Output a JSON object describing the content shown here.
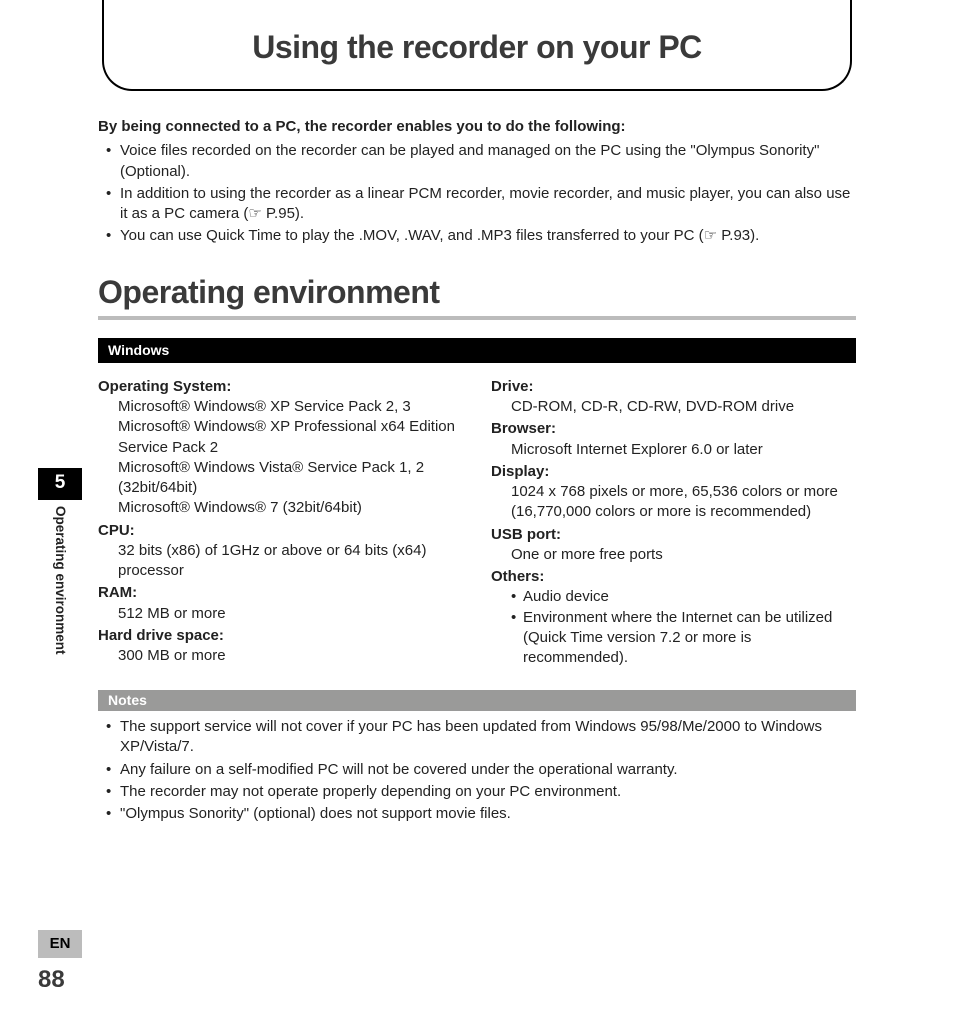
{
  "header": {
    "title": "Using the recorder on your PC"
  },
  "intro": {
    "heading": "By being connected to a PC, the recorder enables you to do the following:",
    "bullets": [
      "Voice files recorded on the recorder can be played and managed on the PC using the \"Olympus Sonority\" (Optional).",
      "In addition to using the recorder as a linear PCM recorder, movie recorder, and music player, you can also use it as a PC camera (☞ P.95).",
      "You can use Quick Time to play the .MOV, .WAV, and .MP3 files transferred to your PC (☞ P.93)."
    ]
  },
  "section": {
    "title": "Operating environment"
  },
  "windows": {
    "bar": "Windows",
    "left": {
      "os_label": "Operating System:",
      "os_lines": [
        "Microsoft® Windows® XP Service Pack 2, 3",
        "Microsoft® Windows® XP Professional x64 Edition Service Pack 2",
        "Microsoft® Windows Vista® Service Pack 1, 2 (32bit/64bit)",
        "Microsoft® Windows® 7 (32bit/64bit)"
      ],
      "cpu_label": "CPU:",
      "cpu": "32 bits (x86) of 1GHz or above or 64 bits (x64) processor",
      "ram_label": "RAM:",
      "ram": "512 MB or more",
      "hdd_label": "Hard drive space:",
      "hdd": "300 MB or more"
    },
    "right": {
      "drive_label": "Drive:",
      "drive": "CD-ROM, CD-R, CD-RW, DVD-ROM drive",
      "browser_label": "Browser:",
      "browser": "Microsoft Internet Explorer 6.0 or later",
      "display_label": "Display:",
      "display": "1024 x 768 pixels or more, 65,536 colors or more (16,770,000 colors or more is recommended)",
      "usb_label": "USB port:",
      "usb": "One or more free ports",
      "others_label": "Others:",
      "others_items": [
        "Audio device",
        "Environment where the Internet can be utilized (Quick Time version 7.2 or more is recommended)."
      ]
    }
  },
  "notes": {
    "bar": "Notes",
    "items": [
      "The support service will not cover if your PC has been updated from Windows 95/98/Me/2000 to Windows XP/Vista/7.",
      "Any failure on a self-modified PC will not be covered under the operational warranty.",
      "The recorder may not operate properly depending on your PC environment.",
      "\"Olympus Sonority\" (optional) does not support movie files."
    ]
  },
  "sidebar": {
    "chapter": "5",
    "label": "Operating environment",
    "lang": "EN",
    "page": "88"
  }
}
